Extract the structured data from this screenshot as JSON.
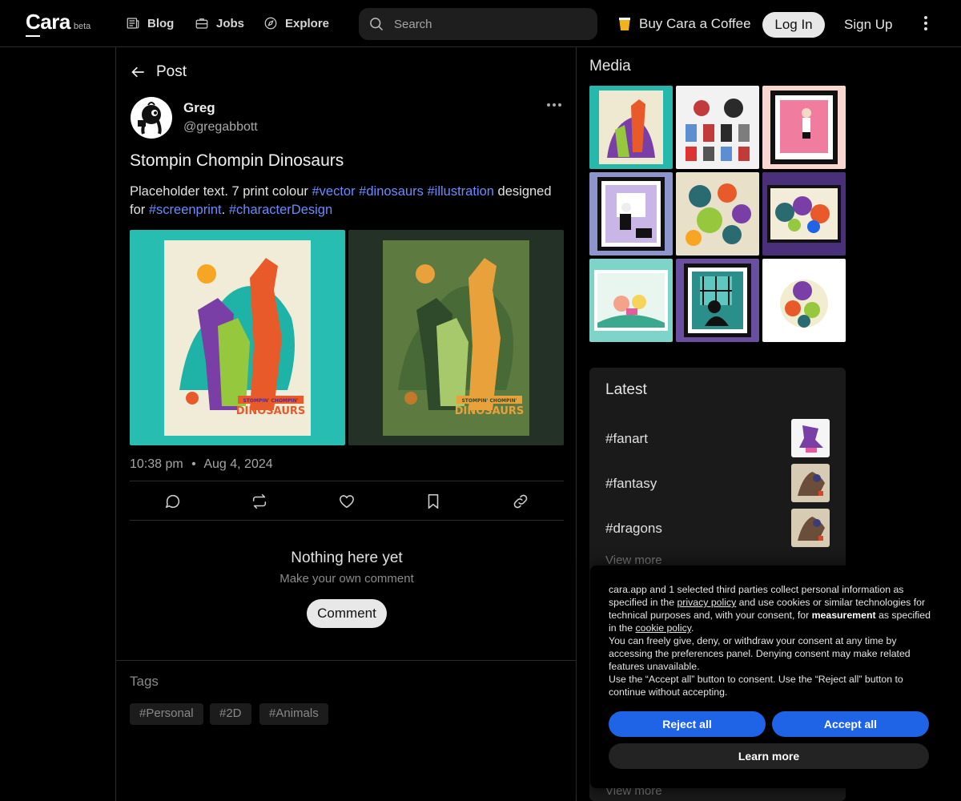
{
  "nav": {
    "logo": "Cara",
    "logo_badge": "beta",
    "links": [
      {
        "label": "Blog",
        "icon": "newspaper-icon"
      },
      {
        "label": "Jobs",
        "icon": "briefcase-icon"
      },
      {
        "label": "Explore",
        "icon": "compass-icon"
      }
    ],
    "search_placeholder": "Search",
    "coffee_label": "Buy Cara a Coffee",
    "login_label": "Log In",
    "signup_label": "Sign Up"
  },
  "post": {
    "back_label": "Post",
    "author_name": "Greg",
    "author_handle": "@gregabbott",
    "title": "Stompin Chompin Dinosaurs",
    "body_text_1": "Placeholder text. 7 print colour ",
    "tags_inline": [
      "#vector",
      "#dinosaurs",
      "#illustration"
    ],
    "body_text_2": " designed for ",
    "tags_inline_2": [
      "#screenprint",
      "#characterDesign"
    ],
    "body_text_3": ".",
    "poster_text_top": "STOMPIN' CHOMPIN'",
    "poster_text_bottom": "DINOSAURS",
    "time": "10:38 pm",
    "separator": "•",
    "date": "Aug 4, 2024",
    "actions": [
      "comment-icon",
      "repost-icon",
      "heart-icon",
      "bookmark-icon",
      "link-icon"
    ],
    "empty_title": "Nothing here yet",
    "empty_sub": "Make your own comment",
    "comment_label": "Comment",
    "tags_title": "Tags",
    "tags": [
      "#Personal",
      "#2D",
      "#Animals"
    ]
  },
  "sidebar": {
    "media_title": "Media",
    "latest_title": "Latest",
    "latest": [
      {
        "label": "#fanart"
      },
      {
        "label": "#fantasy"
      },
      {
        "label": "#dragons"
      }
    ],
    "view_more": "View more"
  },
  "cookie": {
    "p1_a": "cara.app and 1 selected third parties collect personal information as specified in the ",
    "privacy_link": "privacy policy",
    "p1_b": " and use cookies or similar technologies for technical purposes and, with your consent, for ",
    "measurement": "measurement",
    "p1_c": " as specified in the ",
    "cookie_link": "cookie policy",
    "p1_d": ".",
    "p2": "You can freely give, deny, or withdraw your consent at any time by accessing the preferences panel. Denying consent may make related features unavailable.",
    "p3": "Use the “Accept all” button to consent. Use the “Reject all” button to continue without accepting.",
    "reject_label": "Reject all",
    "accept_label": "Accept all",
    "learn_label": "Learn more"
  },
  "colors": {
    "accent_link": "#6a8cff",
    "cookie_button": "#1f63e6",
    "poster_teal": "#27bdb1",
    "poster_dark": "#243126"
  }
}
